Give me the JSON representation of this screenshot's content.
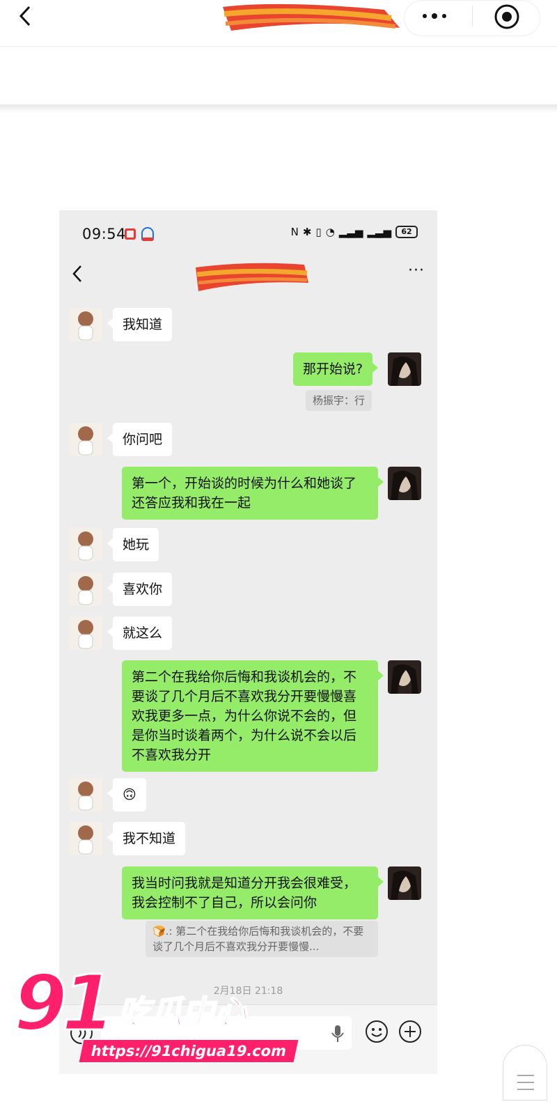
{
  "inner_status": {
    "time": "09:54",
    "battery": "62"
  },
  "chat": {
    "timestamp": "2月18日 21:18",
    "messages": [
      {
        "side": "left",
        "text": "我知道"
      },
      {
        "side": "right",
        "text": "那开始说?",
        "reply": "杨振宇：行"
      },
      {
        "side": "left",
        "text": "你问吧"
      },
      {
        "side": "right",
        "text": "第一个，开始谈的时候为什么和她谈了还答应我和我在一起"
      },
      {
        "side": "left",
        "text": "她玩"
      },
      {
        "side": "left",
        "text": "喜欢你"
      },
      {
        "side": "left",
        "text": "就这么"
      },
      {
        "side": "right",
        "text": "第二个在我给你后悔和我谈机会的，不要谈了几个月后不喜欢我分开要慢慢喜欢我更多一点，为什么你说不会的，但是你当时谈着两个，为什么说不会以后不喜欢我分开"
      },
      {
        "side": "left",
        "text": "🙃"
      },
      {
        "side": "left",
        "text": "我不知道"
      },
      {
        "side": "right",
        "text": "我当时问我就是知道分开我会很难受，我会控制不了自己，所以会问你",
        "quote": "🍞.: 第二个在我给你后悔和我谈机会的，不要谈了几个月后不喜欢我分开要慢慢..."
      }
    ]
  },
  "watermark": {
    "logo_number": "91",
    "logo_text": "吃瓜中心",
    "url": "https://91chigua19.com"
  }
}
